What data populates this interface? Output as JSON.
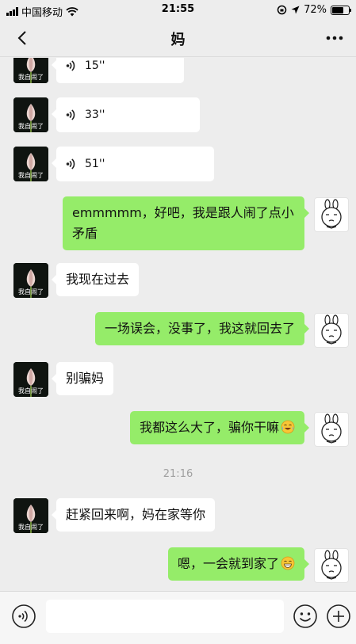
{
  "status_bar": {
    "carrier": "中国移动",
    "time": "21:55",
    "battery_percent": "72%",
    "battery_level": 0.72
  },
  "header": {
    "title": "妈",
    "back_icon": "chevron-left-icon",
    "more_icon": "more-dots-icon"
  },
  "contact": {
    "avatar_caption": "我自闹了"
  },
  "messages": [
    {
      "from": "mom",
      "type": "voice",
      "duration": "15''"
    },
    {
      "from": "mom",
      "type": "voice",
      "duration": "33''"
    },
    {
      "from": "mom",
      "type": "voice",
      "duration": "51''"
    },
    {
      "from": "me",
      "type": "text",
      "text": "emmmmm，好吧，我是跟人闹了点小矛盾"
    },
    {
      "from": "mom",
      "type": "text",
      "text": "我现在过去"
    },
    {
      "from": "me",
      "type": "text",
      "text": "一场误会，没事了，我这就回去了"
    },
    {
      "from": "mom",
      "type": "text",
      "text": "别骗妈"
    },
    {
      "from": "me",
      "type": "text",
      "text": "我都这么大了，骗你干嘛",
      "emoji": "laughing-crying-emoji"
    },
    {
      "from": "system",
      "type": "timestamp",
      "text": "21:16"
    },
    {
      "from": "mom",
      "type": "text",
      "text": "赶紧回来啊，妈在家等你"
    },
    {
      "from": "me",
      "type": "text",
      "text": "嗯，一会就到家了",
      "emoji": "grinning-emoji"
    }
  ],
  "input_bar": {
    "value": "",
    "placeholder": ""
  },
  "colors": {
    "background": "#ededed",
    "outgoing_bubble": "#95ec69",
    "incoming_bubble": "#ffffff"
  }
}
